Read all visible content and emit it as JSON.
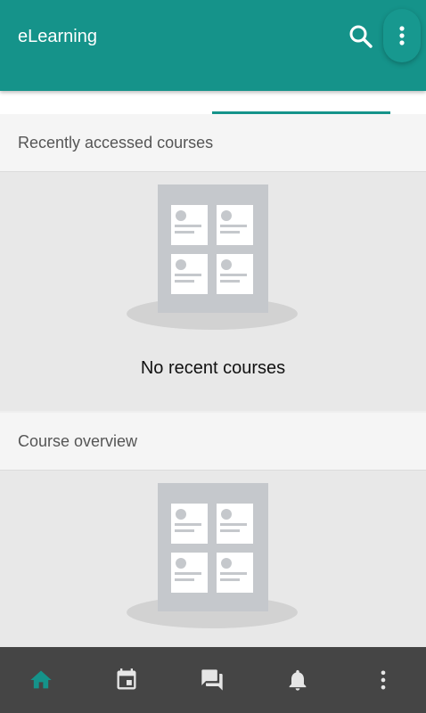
{
  "app": {
    "title": "eLearning"
  },
  "header": {
    "icons": [
      "search-icon",
      "more-vert-icon"
    ],
    "accent_color": "#15938a"
  },
  "sections": [
    {
      "title": "Recently accessed courses",
      "empty_message": "No recent courses"
    },
    {
      "title": "Course overview",
      "empty_message": ""
    }
  ],
  "bottom_nav": {
    "items": [
      {
        "icon": "home-icon",
        "active": true,
        "color": "#15938a"
      },
      {
        "icon": "calendar-icon",
        "active": false
      },
      {
        "icon": "messages-icon",
        "active": false
      },
      {
        "icon": "notifications-icon",
        "active": false
      },
      {
        "icon": "more-vert-icon",
        "active": false
      }
    ]
  }
}
